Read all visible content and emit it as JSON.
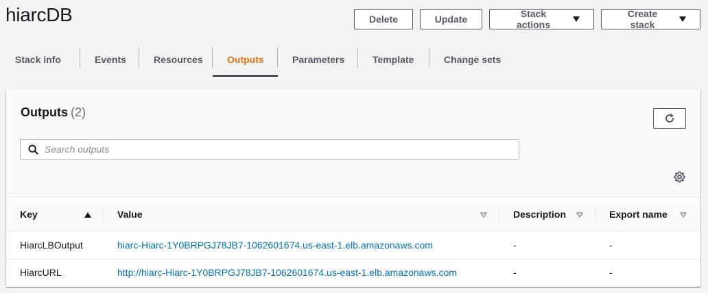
{
  "page": {
    "title": "hiarcDB"
  },
  "actions": {
    "delete": "Delete",
    "update": "Update",
    "stack_actions": "Stack actions",
    "create_stack": "Create stack"
  },
  "tabs": [
    {
      "label": "Stack info",
      "active": false
    },
    {
      "label": "Events",
      "active": false
    },
    {
      "label": "Resources",
      "active": false
    },
    {
      "label": "Outputs",
      "active": true
    },
    {
      "label": "Parameters",
      "active": false
    },
    {
      "label": "Template",
      "active": false
    },
    {
      "label": "Change sets",
      "active": false
    }
  ],
  "outputs": {
    "title": "Outputs",
    "count": "(2)",
    "search_placeholder": "Search outputs",
    "columns": {
      "key": "Key",
      "value": "Value",
      "description": "Description",
      "export_name": "Export name"
    },
    "rows": [
      {
        "key": "HiarcLBOutput",
        "value": "hiarc-Hiarc-1Y0BRPGJ78JB7-1062601674.us-east-1.elb.amazonaws.com",
        "description": "-",
        "export_name": "-"
      },
      {
        "key": "HiarcURL",
        "value": "http://hiarc-Hiarc-1Y0BRPGJ78JB7-1062601674.us-east-1.elb.amazonaws.com",
        "description": "-",
        "export_name": "-"
      }
    ]
  },
  "colors": {
    "accent": "#ec7211",
    "link": "#0073bb",
    "text": "#16191f",
    "muted": "#545b64",
    "background": "#f2f3f3"
  },
  "icons": {
    "dropdown": "caret-down-icon",
    "refresh": "refresh-icon",
    "search": "search-icon",
    "settings": "gear-icon",
    "sort_asc": "sort-ascending-icon",
    "sort_none": "sort-filter-icon"
  }
}
